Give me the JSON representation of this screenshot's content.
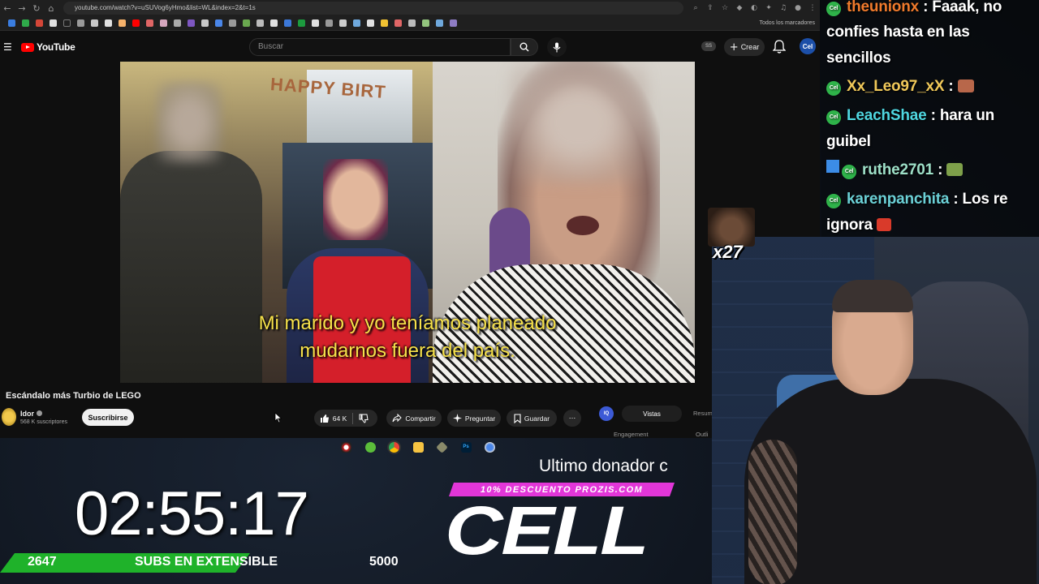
{
  "browser": {
    "url": "youtube.com/watch?v=uSUVog6yHmo&list=WL&index=2&t=1s",
    "all_bookmarks": "Todos los marcadores"
  },
  "youtube": {
    "logo_text": "YouTube",
    "search_placeholder": "Buscar",
    "badge": "SS",
    "create_label": "Crear",
    "account_initials": "Cel"
  },
  "video": {
    "subtitle_line1": "Mi marido y yo teníamos planeado",
    "subtitle_line2": "mudarnos fuera del país.",
    "banner_text": "HAPPY BIRT",
    "title": "Escándalo más Turbio de LEGO",
    "channel_name": "Idor",
    "subscribers": "568 K suscriptores",
    "subscribe_label": "Suscribirse",
    "likes": "64 K",
    "share_label": "Compartir",
    "ask_label": "Preguntar",
    "save_label": "Guardar"
  },
  "engagement_widget": {
    "logo": "IQ",
    "tab_views": "Vistas",
    "tab_summary": "Resum",
    "label_engagement": "Engagement",
    "label_outliers": "Outli"
  },
  "chat": {
    "messages": [
      {
        "user": "theunionx",
        "text": ": Faaak, no",
        "cont": "confies hasta en las",
        "cont2": "sencillos"
      },
      {
        "user": "Xx_Leo97_xX",
        "text": ":"
      },
      {
        "user": "LeachShae",
        "text": ": hara un",
        "cont": "guibel"
      },
      {
        "user": "ruthe2701",
        "text": ":"
      },
      {
        "user": "karenpanchita",
        "text": ": Los re",
        "cont": "ignora"
      }
    ]
  },
  "overlay": {
    "emote_combo": "x27",
    "timer": "02:55:17",
    "subs_current": "2647",
    "subs_label": "SUBS EN EXTENSIBLE",
    "subs_goal": "5000",
    "subs_progress": 0.529,
    "donor_label": "Ultimo donador c",
    "promo": "10% DESCUENTO PROZIS.COM",
    "donor_name": "CELL"
  },
  "colors": {
    "youtube_red": "#ff0000",
    "subtitle_yellow": "#f6e14a",
    "subs_green": "#1fb22a",
    "promo_pink": "#e236d8"
  }
}
